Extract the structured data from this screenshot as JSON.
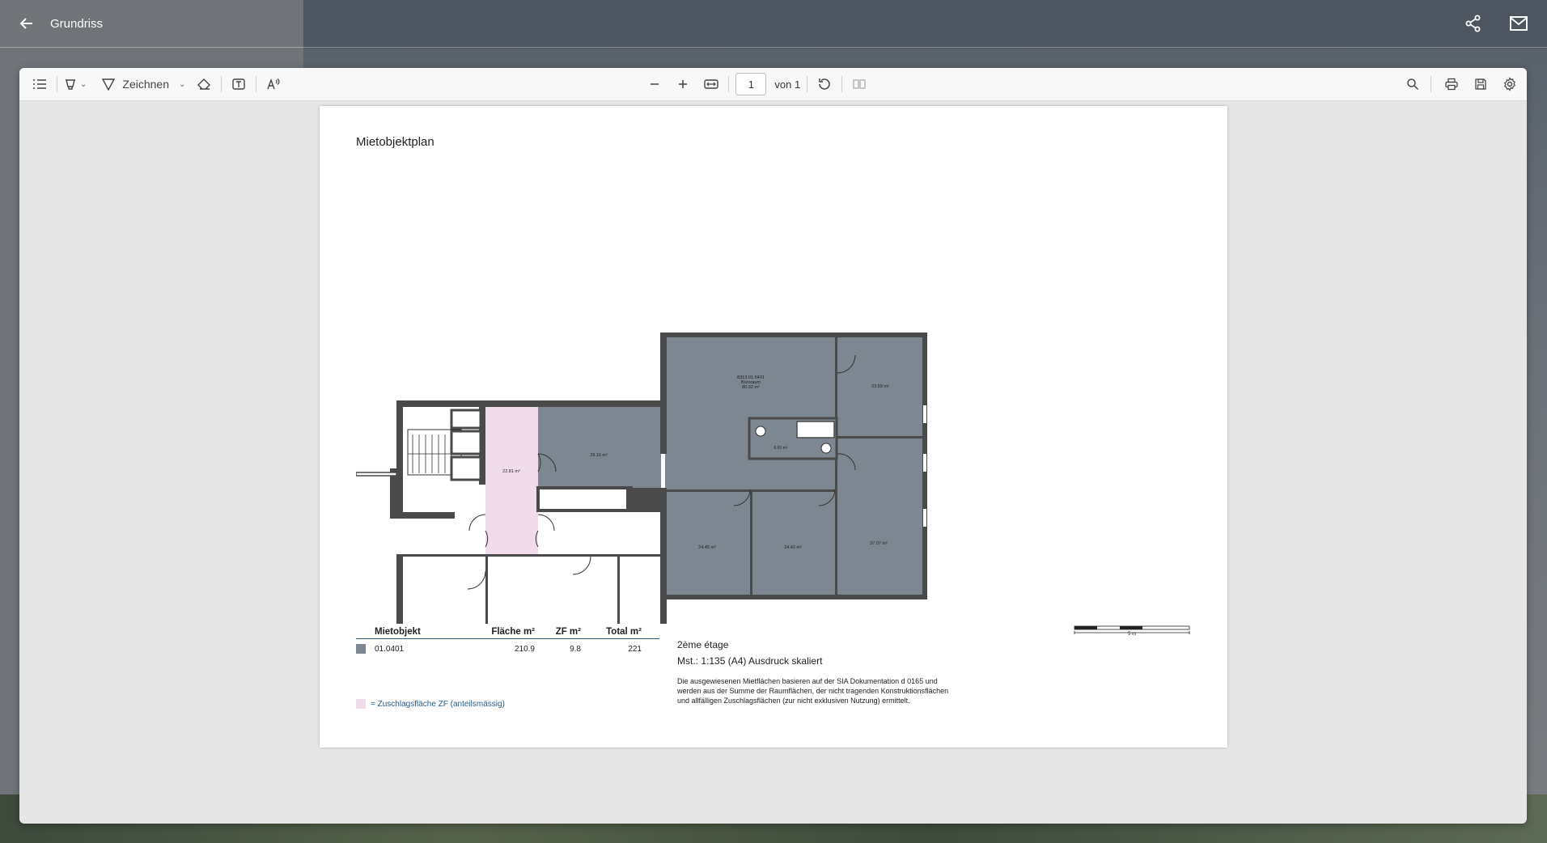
{
  "header": {
    "title": "Grundriss"
  },
  "toolbar": {
    "draw_label": "Zeichnen",
    "page_current": "1",
    "page_of": "von 1"
  },
  "document": {
    "plan_title": "Mietobjektplan",
    "rooms": [
      {
        "label_line1": "8313.01.0401",
        "label_line2": "Büroraum",
        "area": "80.32 m²"
      },
      {
        "area": "23.59 m²"
      },
      {
        "area": "29.16 m²"
      },
      {
        "area": "22.81 m²"
      },
      {
        "area": "6.60 m²"
      },
      {
        "area": "24.45 m²"
      },
      {
        "area": "24.42 m²"
      },
      {
        "area": "37.07 m²"
      }
    ],
    "legend": {
      "headers": [
        "Mietobjekt",
        "Fläche m²",
        "ZF m²",
        "Total m²"
      ],
      "rows": [
        {
          "id": "01.0401",
          "flaeche": "210.9",
          "zf": "9.8",
          "total": "221"
        }
      ],
      "zf_note": "= Zuschlagsfläche ZF (anteilsmässig)"
    },
    "floor": "2ème étage",
    "scale_text": "Mst.: 1:135 (A4) Ausdruck skaliert",
    "note": "Die ausgewiesenen Mietflächen basieren auf der SIA Dokumentation d 0165 und werden aus der Summe der Raumflächen, der nicht tragenden Konstruktionsflächen und allfälligen Zuschlagsflächen (zur nicht exklusiven Nutzung) ermittelt.",
    "scalebar_label": "5 m"
  },
  "colors": {
    "rental_area": "#7c8791",
    "zf_area": "#f1dcec",
    "wall": "#4a4a4a"
  }
}
